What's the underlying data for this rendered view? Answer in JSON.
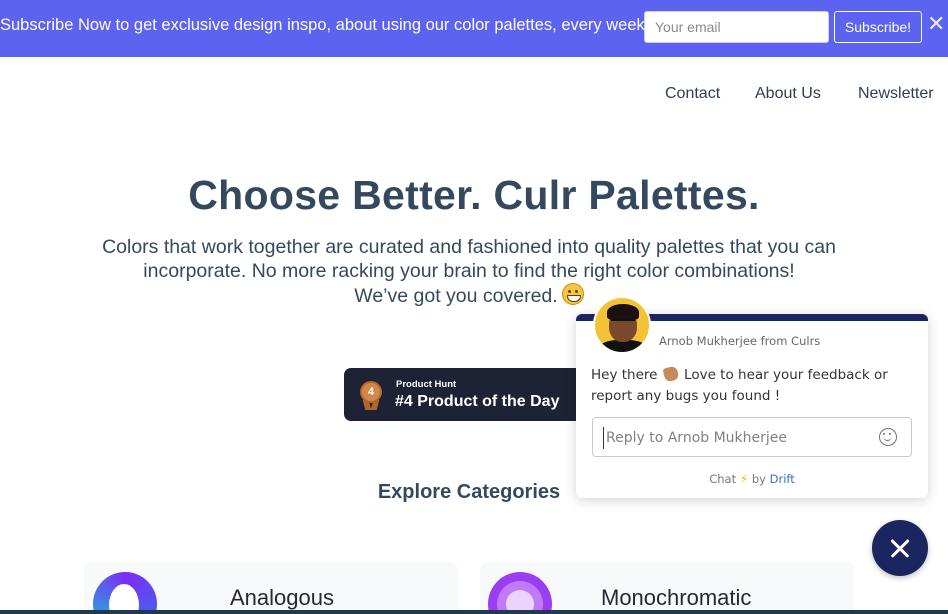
{
  "banner": {
    "text": "Subscribe Now to get exclusive design inspo, about using our color palettes, every week!",
    "email_placeholder": "Your email",
    "subscribe_label": "Subscribe!",
    "close_glyph": "✕",
    "background_color": "#5b63f0"
  },
  "nav": {
    "items": [
      {
        "label": "Contact"
      },
      {
        "label": "About Us"
      },
      {
        "label": "Newsletter"
      }
    ]
  },
  "hero": {
    "title": "Choose Better. Culr Palettes.",
    "subtitle_line1": "Colors that work together are curated and fashioned into quality palettes that you can incorporate. No more racking your brain to find the right color combinations!",
    "subtitle_line2": "We’ve got you covered.",
    "emoji_icon": "grinning-face-icon"
  },
  "product_hunt": {
    "small_label": "Product Hunt",
    "big_label": "#4 Product of the Day",
    "medal_number": "4"
  },
  "explore": {
    "heading": "Explore Categories",
    "categories": [
      {
        "label": "Analogous"
      },
      {
        "label": "Monochromatic"
      }
    ]
  },
  "chat": {
    "from": "Arnob Mukherjee from Culrs",
    "message_before_icon": "Hey there",
    "message_after_icon": "Love to hear your feedback or report any bugs you found !",
    "reply_placeholder": "Reply to Arnob Mukherjee",
    "footer_prefix": "Chat",
    "footer_by": "by",
    "footer_brand": "Drift",
    "accent_color": "#1b2560"
  }
}
